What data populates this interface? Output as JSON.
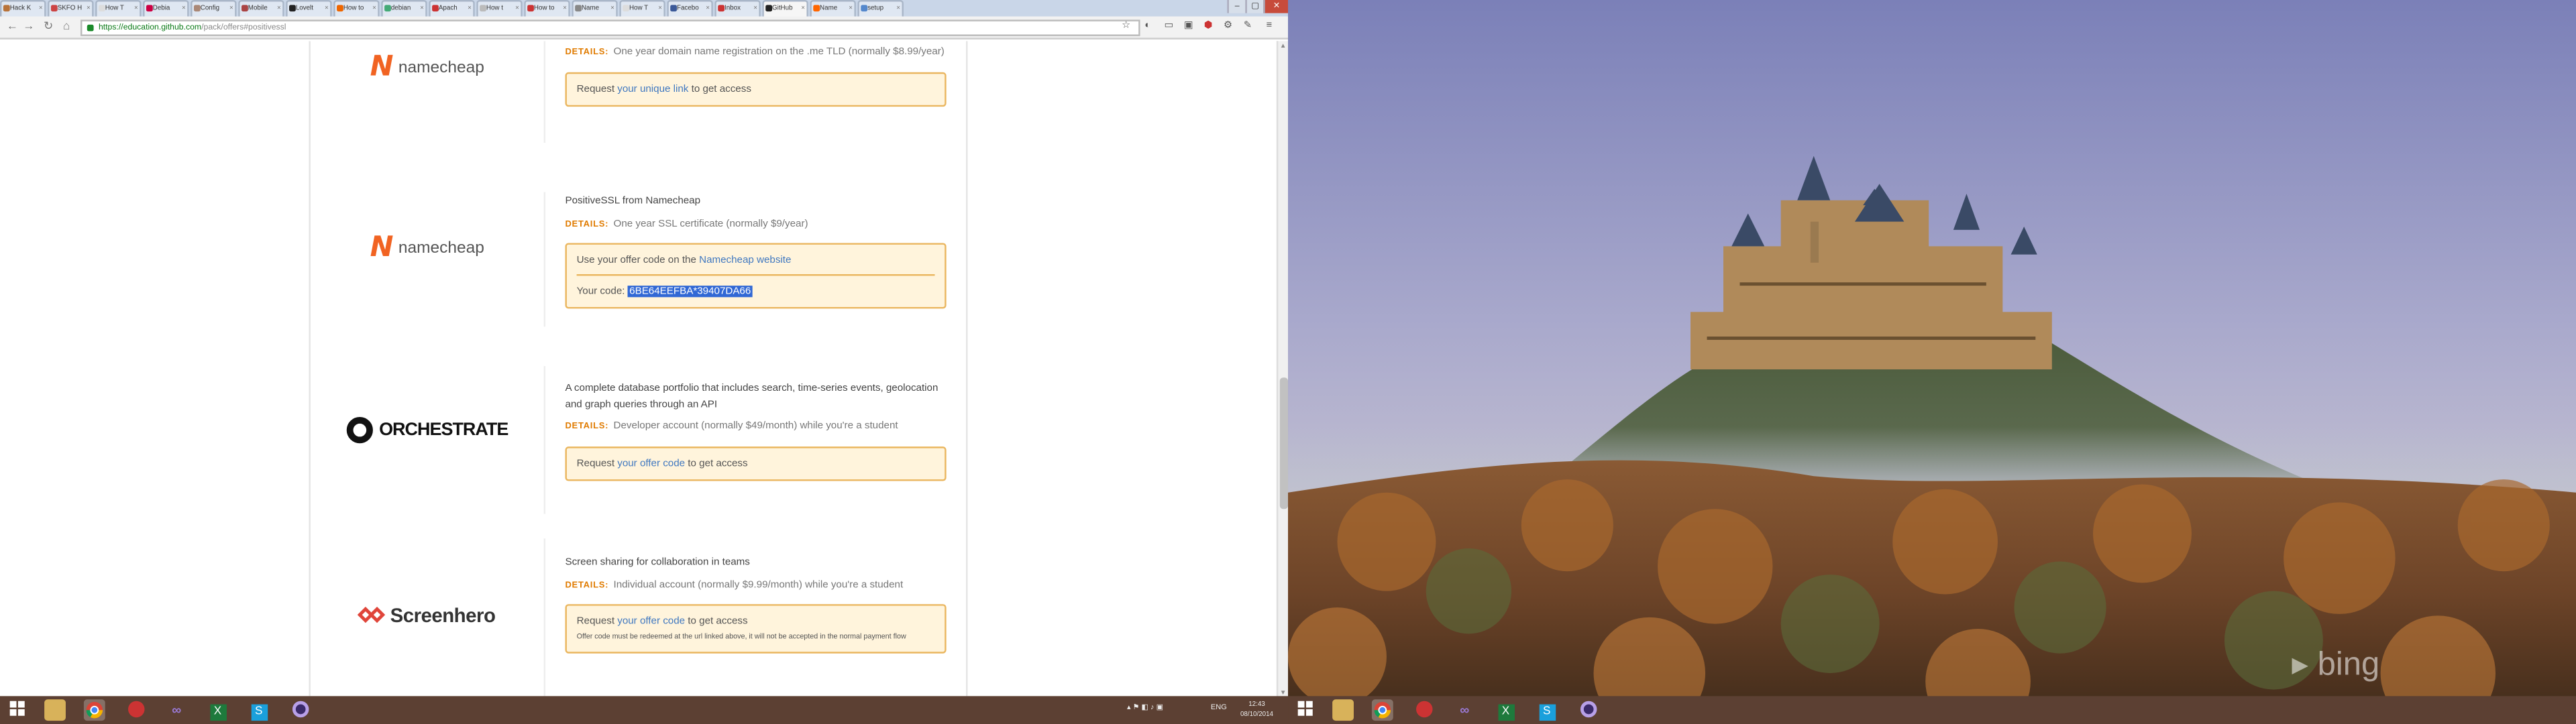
{
  "browser": {
    "tabs": [
      {
        "label": "Hack K",
        "color": "#b8733a"
      },
      {
        "label": "SKFO H",
        "color": "#c44"
      },
      {
        "label": "How T",
        "color": "#ddd"
      },
      {
        "label": "Debia",
        "color": "#c04"
      },
      {
        "label": "Config",
        "color": "#a87"
      },
      {
        "label": "Mobile",
        "color": "#a44"
      },
      {
        "label": "Lovelt",
        "color": "#222"
      },
      {
        "label": "How to",
        "color": "#e60"
      },
      {
        "label": "debian",
        "color": "#4a7"
      },
      {
        "label": "Apach",
        "color": "#c33"
      },
      {
        "label": "How t",
        "color": "#bbb"
      },
      {
        "label": "How to",
        "color": "#c33"
      },
      {
        "label": "Name",
        "color": "#888"
      },
      {
        "label": "How T",
        "color": "#ddd"
      },
      {
        "label": "Facebo",
        "color": "#3b5998"
      },
      {
        "label": "Inbox",
        "color": "#c33"
      },
      {
        "label": "GitHub",
        "color": "#222"
      },
      {
        "label": "Name",
        "color": "#f60"
      },
      {
        "label": "setup",
        "color": "#58c"
      }
    ],
    "active_tab_index": 16,
    "url_scheme": "https://",
    "url_domain": "education.github.com",
    "url_rest": "/pack/offers#positivessl"
  },
  "offers": [
    {
      "logo": "namecheap",
      "logo_text": "namecheap",
      "description": "",
      "details_label": "DETAILS:",
      "details": "One year domain name registration on the .me TLD (normally $8.99/year)",
      "notice_pre": "Request ",
      "notice_link": "your unique link",
      "notice_post": " to get access"
    },
    {
      "logo": "namecheap",
      "logo_text": "namecheap",
      "description": "PositiveSSL from Namecheap",
      "details_label": "DETAILS:",
      "details": "One year SSL certificate (normally $9/year)",
      "notice_pre": "Use your offer code on the ",
      "notice_link": "Namecheap website",
      "code_label": "Your code: ",
      "code": "6BE64EEFBA*39407DA66"
    },
    {
      "logo": "orchestrate",
      "logo_text": "ORCHESTRATE",
      "description": "A complete database portfolio that includes search, time-series events, geolocation and graph queries through an API",
      "details_label": "DETAILS:",
      "details": "Developer account (normally $49/month) while you're a student",
      "notice_pre": "Request ",
      "notice_link": "your offer code",
      "notice_post": " to get access"
    },
    {
      "logo": "screenhero",
      "logo_text": "Screenhero",
      "description": "Screen sharing for collaboration in teams",
      "details_label": "DETAILS:",
      "details": "Individual account (normally $9.99/month) while you're a student",
      "notice_pre": "Request ",
      "notice_link": "your offer code",
      "notice_post": " to get access",
      "notice_small": "Offer code must be redeemed at the url linked above, it will not be accepted in the normal payment flow"
    }
  ],
  "taskbar_left": {
    "tray": "ENG",
    "time": "12:43",
    "date": "08/10/2014"
  },
  "wallpaper_brand": "bing",
  "colors": {
    "accent_orange": "#e07b00",
    "link_blue": "#4078c0",
    "namecheap": "#f16322",
    "screenhero": "#e0453a",
    "taskbar": "#5c4033"
  }
}
